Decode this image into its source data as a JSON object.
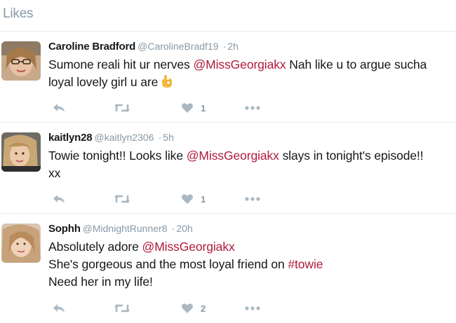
{
  "header": {
    "title": "Likes"
  },
  "colors": {
    "accent": "#b0193d",
    "muted": "#8899a6",
    "icon": "#aab8c2",
    "divider": "#e6ecf0"
  },
  "tweets": [
    {
      "name": "Caroline Bradford",
      "handle": "@CarolineBradf19",
      "separator": "·",
      "time": "2h",
      "text": {
        "l1a": "Sumone reali hit ur nerves ",
        "l1m": "@MissGeorgiakx",
        "l1b": " Nah like u to argue sucha",
        "l2": "loyal lovely girl u are"
      },
      "emoji": "ok-hand-emoji",
      "likes": "1"
    },
    {
      "name": "kaitlyn28",
      "handle": "@kaitlyn2306",
      "separator": "·",
      "time": "5h",
      "text": {
        "l1a": "Towie tonight!! Looks like ",
        "l1m": "@MissGeorgiakx",
        "l1b": " slays in tonight's episode!!",
        "l2": "xx"
      },
      "likes": "1"
    },
    {
      "name": "Sophh",
      "handle": "@MidnightRunner8",
      "separator": "·",
      "time": "20h",
      "text": {
        "l1a": "Absolutely adore ",
        "l1m": "@MissGeorgiakx",
        "l2a": "She's gorgeous and the most loyal friend on ",
        "l2h": "#towie",
        "l3": "Need her in my life!"
      },
      "likes": "2"
    }
  ],
  "icons": {
    "reply": "reply-icon",
    "retweet": "retweet-icon",
    "like": "heart-icon",
    "more": "more-icon"
  }
}
